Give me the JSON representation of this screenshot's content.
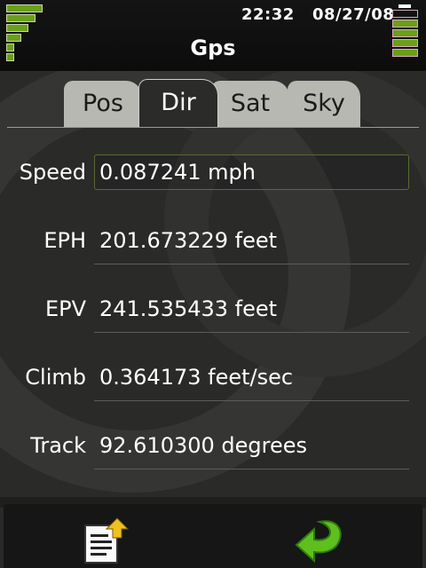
{
  "status": {
    "time": "22:32",
    "date": "08/27/08",
    "signal_icon": "signal-strength-icon",
    "battery_icon": "battery-icon"
  },
  "app": {
    "title": "Gps"
  },
  "tabs": [
    {
      "label": "Pos",
      "active": false
    },
    {
      "label": "Dir",
      "active": true
    },
    {
      "label": "Sat",
      "active": false
    },
    {
      "label": "Sky",
      "active": false
    }
  ],
  "fields": {
    "speed": {
      "label": "Speed",
      "value": "0.087241 mph"
    },
    "eph": {
      "label": "EPH",
      "value": "201.673229 feet"
    },
    "epv": {
      "label": "EPV",
      "value": "241.535433 feet"
    },
    "climb": {
      "label": "Climb",
      "value": "0.364173 feet/sec"
    },
    "track": {
      "label": "Track",
      "value": "92.610300 degrees"
    }
  },
  "toolbar": {
    "left_icon": "export-document-icon",
    "right_icon": "back-arrow-icon"
  },
  "colors": {
    "accent": "#6aa018",
    "tab_inactive": "#b7b8b2"
  }
}
